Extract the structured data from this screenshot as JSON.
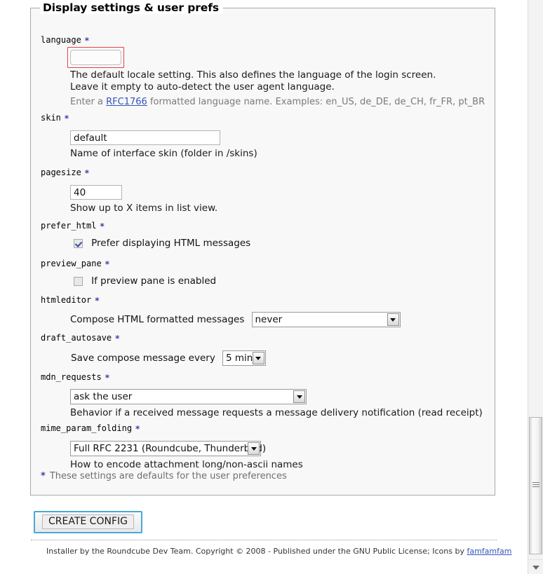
{
  "fieldset": {
    "legend": "Display settings & user prefs"
  },
  "settings": [
    {
      "name": "language",
      "label": "language",
      "required_marker": "*",
      "control": "text",
      "value": "",
      "error": true,
      "hint_lines": [
        "The default locale setting. This also defines the language of the login screen.",
        "Leave it empty to auto-detect the user agent language."
      ],
      "example_prefix": "Enter a ",
      "example_link": "RFC1766",
      "example_suffix": " formatted language name. Examples: en_US, de_DE, de_CH, fr_FR, pt_BR"
    },
    {
      "name": "skin",
      "label": "skin",
      "required_marker": "*",
      "control": "text",
      "value": "default",
      "hint_lines": [
        "Name of interface skin (folder in /skins)"
      ]
    },
    {
      "name": "pagesize",
      "label": "pagesize",
      "required_marker": "*",
      "control": "text",
      "value": "40",
      "hint_lines": [
        "Show up to X items in list view."
      ]
    },
    {
      "name": "prefer_html",
      "label": "prefer_html",
      "required_marker": "*",
      "control": "checkbox",
      "checked": true,
      "checkbox_label": "Prefer displaying HTML messages"
    },
    {
      "name": "preview_pane",
      "label": "preview_pane",
      "required_marker": "*",
      "control": "checkbox",
      "checked": false,
      "checkbox_label": "If preview pane is enabled"
    },
    {
      "name": "htmleditor",
      "label": "htmleditor",
      "required_marker": "*",
      "control": "select",
      "prefix_label": "Compose HTML formatted messages",
      "value": "never"
    },
    {
      "name": "draft_autosave",
      "label": "draft_autosave",
      "required_marker": "*",
      "control": "select",
      "prefix_label": "Save compose message every",
      "value": "5 min"
    },
    {
      "name": "mdn_requests",
      "label": "mdn_requests",
      "required_marker": "*",
      "control": "select",
      "value": "ask the user",
      "hint_lines": [
        "Behavior if a received message requests a message delivery notification (read receipt)"
      ]
    },
    {
      "name": "mime_param_folding",
      "label": "mime_param_folding",
      "required_marker": "*",
      "control": "select",
      "value": "Full RFC 2231 (Roundcube, Thunderbird)",
      "hint_lines": [
        "How to encode attachment long/non-ascii names"
      ]
    }
  ],
  "footnote": {
    "star": "*",
    "text": "These settings are defaults for the user preferences"
  },
  "actions": {
    "create_config": "CREATE CONFIG"
  },
  "footer": {
    "text": "Installer by the Roundcube Dev Team. Copyright © 2008 - Published under the GNU Public License;  Icons by ",
    "link": "famfamfam"
  },
  "colors": {
    "accent": "#49a8d8",
    "required": "#3b43a8",
    "error": "#e04141",
    "link": "#3355bb",
    "panel_bg": "#f8f8f8",
    "panel_border": "#a8a8a8"
  }
}
